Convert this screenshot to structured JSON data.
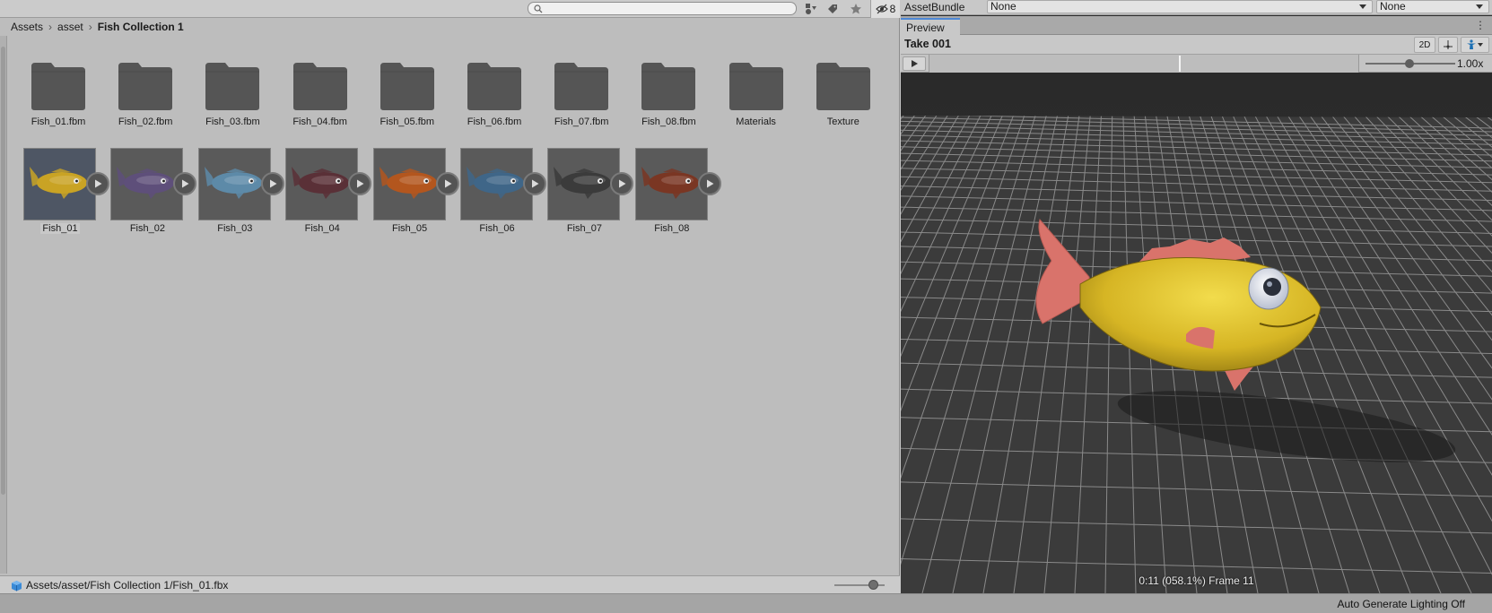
{
  "project": {
    "search": {
      "placeholder": "",
      "value": ""
    },
    "hidden_count": "8",
    "breadcrumb": [
      "Assets",
      "asset",
      "Fish Collection 1"
    ],
    "folders": [
      {
        "name": "Fish_01.fbm"
      },
      {
        "name": "Fish_02.fbm"
      },
      {
        "name": "Fish_03.fbm"
      },
      {
        "name": "Fish_04.fbm"
      },
      {
        "name": "Fish_05.fbm"
      },
      {
        "name": "Fish_06.fbm"
      },
      {
        "name": "Fish_07.fbm"
      },
      {
        "name": "Fish_08.fbm"
      },
      {
        "name": "Materials"
      },
      {
        "name": "Texture"
      }
    ],
    "assets": [
      {
        "name": "Fish_01",
        "color": "#c9a324",
        "selected": true
      },
      {
        "name": "Fish_02",
        "color": "#5e4f7a",
        "selected": false
      },
      {
        "name": "Fish_03",
        "color": "#5d8aa8",
        "selected": false
      },
      {
        "name": "Fish_04",
        "color": "#5a3037",
        "selected": false
      },
      {
        "name": "Fish_05",
        "color": "#b3561e",
        "selected": false
      },
      {
        "name": "Fish_06",
        "color": "#3f6688",
        "selected": false
      },
      {
        "name": "Fish_07",
        "color": "#3b3b3b",
        "selected": false
      },
      {
        "name": "Fish_08",
        "color": "#7a3623",
        "selected": false
      }
    ],
    "footer_path": "Assets/asset/Fish Collection 1/Fish_01.fbx"
  },
  "inspector": {
    "assetbundle_label": "AssetBundle",
    "assetbundle_value": "None",
    "assetbundle_variant": "None",
    "preview_tab": "Preview",
    "take_label": "Take 001",
    "view_2d": "2D",
    "speed": "1.00x",
    "frame_info": "0:11 (058.1%) Frame 11"
  },
  "statusbar": {
    "text": "Auto Generate Lighting Off"
  },
  "colors": {
    "accent": "#4d88d6",
    "fish_body": "#d9b82a",
    "fish_fin": "#d9736b"
  }
}
